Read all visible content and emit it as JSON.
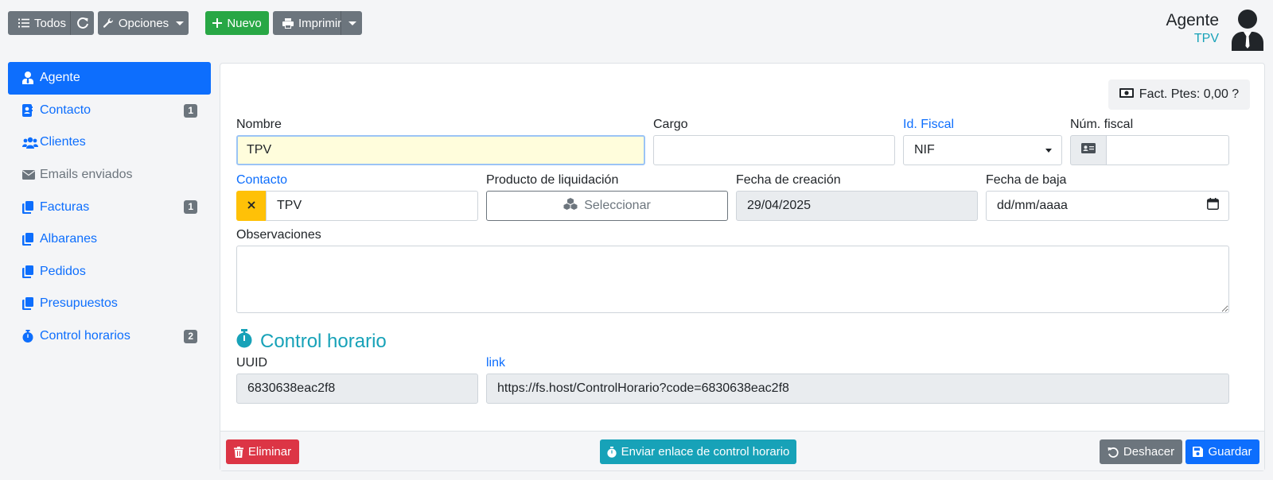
{
  "toolbar": {
    "todos_label": "Todos",
    "opciones_label": "Opciones",
    "nuevo_label": "Nuevo",
    "imprimir_label": "Imprimir"
  },
  "header": {
    "title": "Agente",
    "subtitle": "TPV"
  },
  "sidebar": {
    "items": [
      {
        "label": "Agente",
        "icon": "user-tie-icon",
        "badge": ""
      },
      {
        "label": "Contacto",
        "icon": "address-book-icon",
        "badge": "1"
      },
      {
        "label": "Clientes",
        "icon": "users-icon",
        "badge": ""
      },
      {
        "label": "Emails enviados",
        "icon": "envelope-icon",
        "badge": ""
      },
      {
        "label": "Facturas",
        "icon": "copy-icon",
        "badge": "1"
      },
      {
        "label": "Albaranes",
        "icon": "copy-icon",
        "badge": ""
      },
      {
        "label": "Pedidos",
        "icon": "copy-icon",
        "badge": ""
      },
      {
        "label": "Presupuestos",
        "icon": "copy-icon",
        "badge": ""
      },
      {
        "label": "Control horarios",
        "icon": "stopwatch-icon",
        "badge": "2"
      }
    ]
  },
  "pending_invoices": "Fact. Ptes: 0,00 ?",
  "form": {
    "nombre": {
      "label": "Nombre",
      "value": "TPV"
    },
    "cargo": {
      "label": "Cargo",
      "value": ""
    },
    "id_fiscal": {
      "label": "Id. Fiscal",
      "value": "NIF"
    },
    "num_fiscal": {
      "label": "Núm. fiscal",
      "value": ""
    },
    "contacto": {
      "label": "Contacto",
      "value": "TPV"
    },
    "producto": {
      "label": "Producto de liquidación",
      "button": "Seleccionar"
    },
    "fecha_creacion": {
      "label": "Fecha de creación",
      "value": "29/04/2025"
    },
    "fecha_baja": {
      "label": "Fecha de baja",
      "placeholder": "dd/mm/aaaa"
    },
    "observaciones": {
      "label": "Observaciones",
      "value": ""
    }
  },
  "control_horario": {
    "title": "Control horario",
    "uuid_label": "UUID",
    "uuid_value": "6830638eac2f8",
    "link_label": "link",
    "link_value": "https://fs.host/ControlHorario?code=6830638eac2f8"
  },
  "footer": {
    "eliminar": "Eliminar",
    "enviar": "Enviar enlace de control horario",
    "deshacer": "Deshacer",
    "guardar": "Guardar"
  },
  "colors": {
    "primary": "#0d6efd",
    "secondary": "#6c757d",
    "success": "#28a745",
    "danger": "#dc3545",
    "info": "#17a2b8",
    "warning": "#ffc107"
  }
}
